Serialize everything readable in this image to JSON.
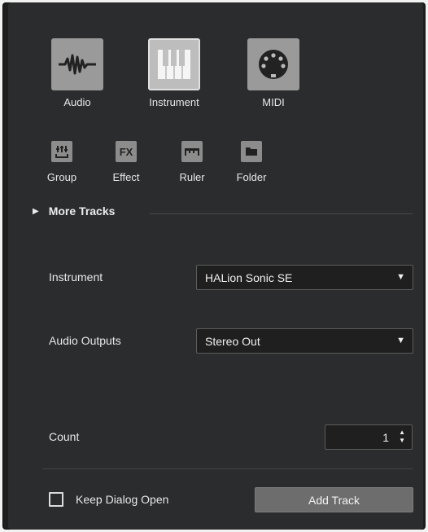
{
  "track_types": {
    "primary": [
      {
        "label": "Audio",
        "icon": "waveform-icon",
        "selected": false
      },
      {
        "label": "Instrument",
        "icon": "piano-keys-icon",
        "selected": true
      },
      {
        "label": "MIDI",
        "icon": "midi-port-icon",
        "selected": false
      }
    ],
    "secondary": [
      {
        "label": "Group",
        "icon": "group-icon",
        "glyph": "Ш"
      },
      {
        "label": "Effect",
        "icon": "fx-icon",
        "glyph": "FX"
      },
      {
        "label": "Ruler",
        "icon": "ruler-icon",
        "glyph": ""
      },
      {
        "label": "Folder",
        "icon": "folder-icon",
        "glyph": ""
      }
    ]
  },
  "more_tracks": {
    "label": "More Tracks"
  },
  "instrument": {
    "label": "Instrument",
    "value": "HALion Sonic SE"
  },
  "audio_outputs": {
    "label": "Audio Outputs",
    "value": "Stereo Out"
  },
  "count": {
    "label": "Count",
    "value": "1"
  },
  "keep_open": {
    "label": "Keep Dialog Open",
    "checked": false
  },
  "add_track": {
    "label": "Add Track"
  },
  "colors": {
    "panel": "#2b2c2d",
    "icon_bg": "#9a9a9a",
    "selected_icon_bg": "#bdbdbd",
    "button": "#6d6d6d"
  }
}
